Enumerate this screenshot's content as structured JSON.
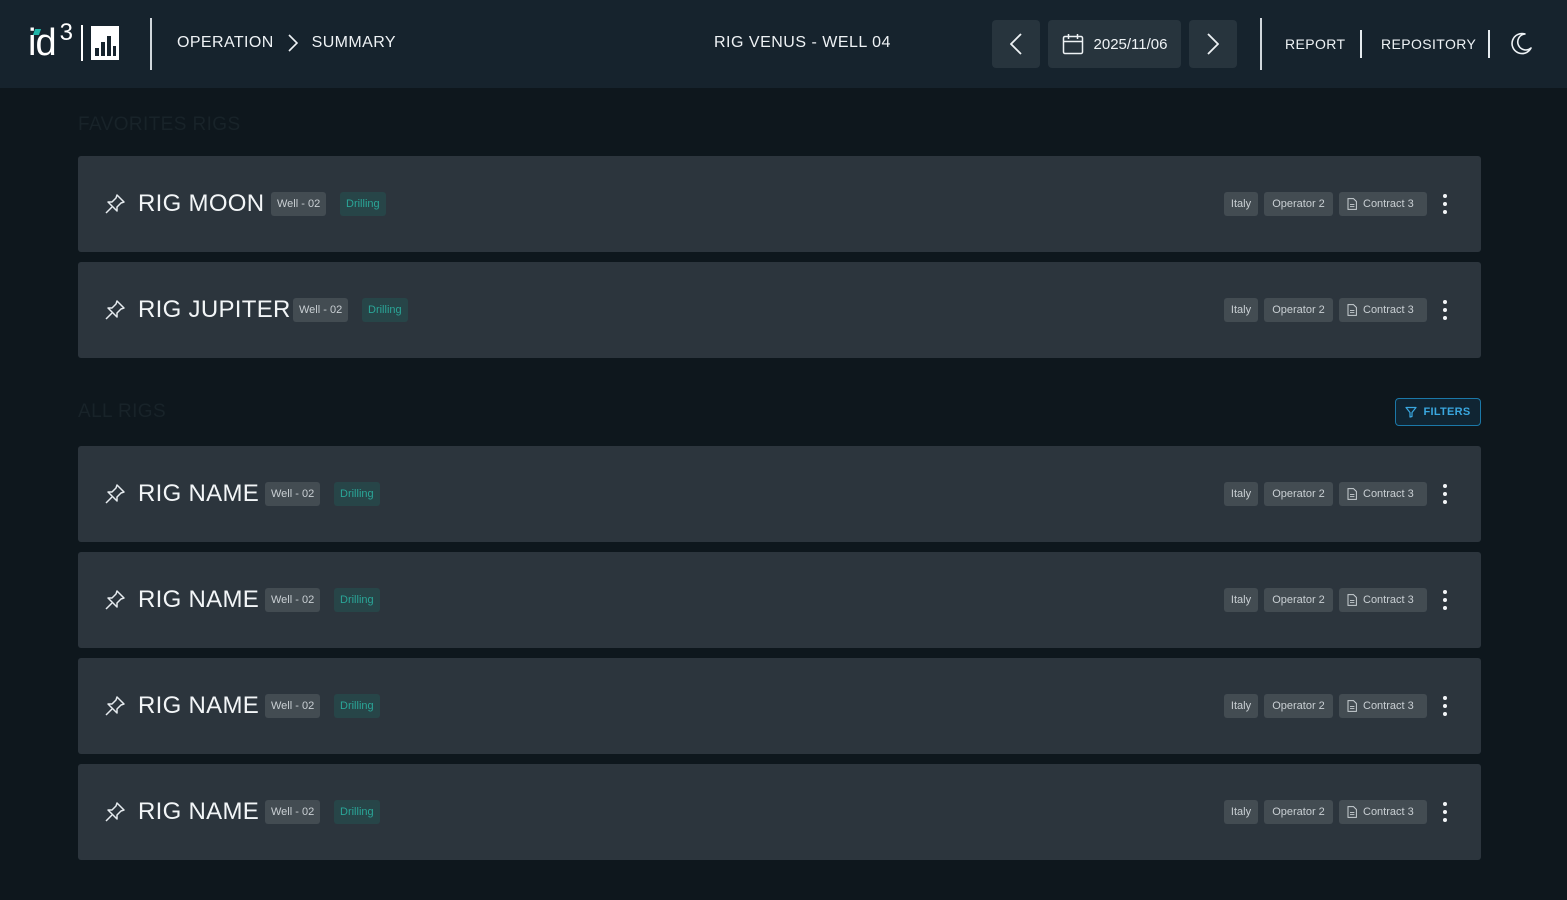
{
  "header": {
    "breadcrumb": [
      "OPERATION",
      "SUMMARY"
    ],
    "rig_title": "RIG VENUS - WELL 04",
    "date": "2025/11/06",
    "report_label": "REPORT",
    "repository_label": "REPOSITORY"
  },
  "logo": {
    "text": "id",
    "sup": "3"
  },
  "sections": {
    "favorites_label": "FAVORITES RIGS",
    "all_label": "ALL RIGS",
    "filters_label": "FILTERS"
  },
  "favorites": [
    {
      "name": "RIG MOON",
      "well": "Well - 02",
      "status": "Drilling",
      "country": "Italy",
      "operator": "Operator 2",
      "contract": "Contract 3"
    },
    {
      "name": "RIG JUPITER",
      "well": "Well - 02",
      "status": "Drilling",
      "country": "Italy",
      "operator": "Operator 2",
      "contract": "Contract 3"
    }
  ],
  "rigs": [
    {
      "name": "RIG NAME",
      "well": "Well - 02",
      "status": "Drilling",
      "country": "Italy",
      "operator": "Operator 2",
      "contract": "Contract 3"
    },
    {
      "name": "RIG NAME",
      "well": "Well - 02",
      "status": "Drilling",
      "country": "Italy",
      "operator": "Operator 2",
      "contract": "Contract 3"
    },
    {
      "name": "RIG NAME",
      "well": "Well - 02",
      "status": "Drilling",
      "country": "Italy",
      "operator": "Operator 2",
      "contract": "Contract 3"
    },
    {
      "name": "RIG NAME",
      "well": "Well - 02",
      "status": "Drilling",
      "country": "Italy",
      "operator": "Operator 2",
      "contract": "Contract 3"
    }
  ],
  "icons": {
    "pin": "pin-icon",
    "calendar": "calendar-icon",
    "prev": "chevron-left-icon",
    "next": "chevron-right-icon",
    "theme": "moon-icon",
    "filter": "filter-icon",
    "more": "more-vertical-icon",
    "document": "document-icon"
  },
  "colors": {
    "accent": "#1fb5a8",
    "filter": "#3aa7df",
    "background": "#0e171d",
    "card": "#2c353d"
  }
}
